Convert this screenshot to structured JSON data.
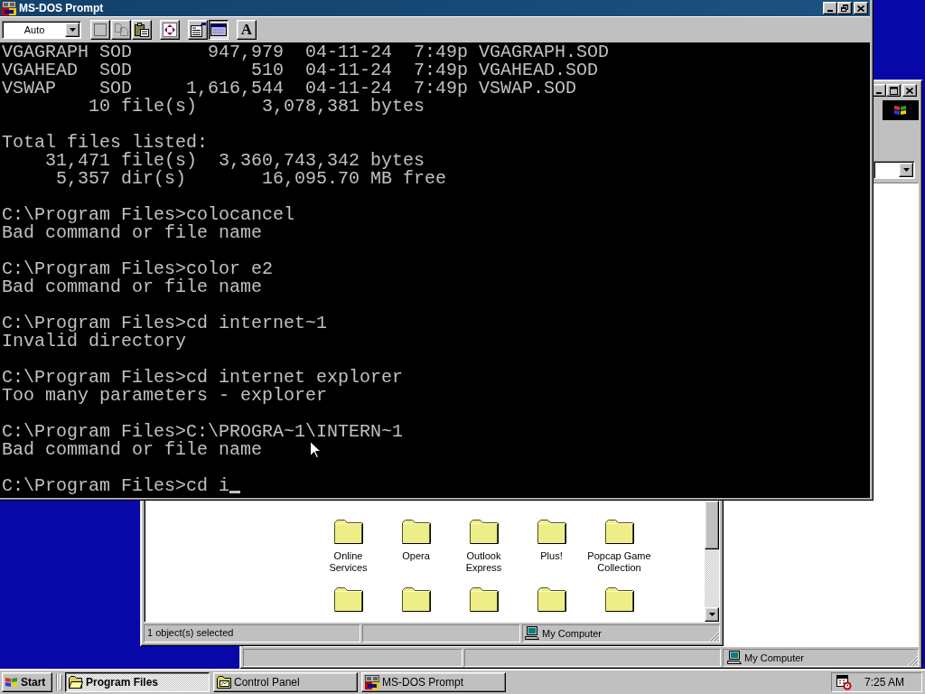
{
  "dos_window": {
    "title": "MS-DOS Prompt",
    "font_size": "Auto",
    "toolbar": [
      {
        "kind": "mark",
        "disabled": false,
        "pressed": false
      },
      {
        "kind": "copy",
        "disabled": true,
        "pressed": false
      },
      {
        "kind": "paste",
        "disabled": false,
        "pressed": false
      },
      {
        "kind": "fullscreen",
        "disabled": false,
        "pressed": false
      },
      {
        "kind": "properties",
        "disabled": false,
        "pressed": false
      },
      {
        "kind": "background",
        "disabled": false,
        "pressed": true
      },
      {
        "kind": "font",
        "label": "A",
        "disabled": false,
        "pressed": false
      }
    ],
    "console_blocks": [
      [
        "VGAGRAPH SOD       947,979  04-11-24  7:49p VGAGRAPH.SOD",
        "VGAHEAD  SOD           510  04-11-24  7:49p VGAHEAD.SOD",
        "VSWAP    SOD     1,616,544  04-11-24  7:49p VSWAP.SOD",
        "        10 file(s)      3,078,381 bytes"
      ],
      [
        "Total files listed:",
        "    31,471 file(s)  3,360,743,342 bytes",
        "     5,357 dir(s)       16,095.70 MB free"
      ],
      [
        "C:\\Program Files>colocancel",
        "Bad command or file name"
      ],
      [
        "C:\\Program Files>color e2",
        "Bad command or file name"
      ],
      [
        "C:\\Program Files>cd internet~1",
        "Invalid directory"
      ],
      [
        "C:\\Program Files>cd internet explorer",
        "Too many parameters - explorer"
      ],
      [
        "C:\\Program Files>C:\\PROGRA~1\\INTERN~1",
        "Bad command or file name"
      ],
      [
        "C:\\Program Files>cd i"
      ]
    ]
  },
  "control_panel_window": {
    "status_bar": {
      "zone": "My Computer"
    }
  },
  "explorer_window": {
    "folders": [
      {
        "kind": "folder",
        "label": "Online Services"
      },
      {
        "kind": "folder",
        "label": "Opera"
      },
      {
        "kind": "folder",
        "label": "Outlook Express"
      },
      {
        "kind": "folder",
        "label": "Plus!"
      },
      {
        "kind": "folder",
        "label": "Popcap Game Collection"
      },
      {
        "kind": "folder"
      },
      {
        "kind": "folder"
      },
      {
        "kind": "folder"
      },
      {
        "kind": "folder"
      },
      {
        "kind": "folder"
      }
    ],
    "status_bar": {
      "selection": "1 object(s) selected",
      "zone": "My Computer"
    }
  },
  "taskbar": {
    "start": "Start",
    "buttons": [
      {
        "kind": "folder",
        "label": "Program Files",
        "selected": true
      },
      {
        "kind": "control_panel",
        "label": "Control Panel",
        "selected": false
      },
      {
        "kind": "dos",
        "label": "MS-DOS Prompt",
        "selected": false
      }
    ],
    "clock": "7:25 AM"
  }
}
